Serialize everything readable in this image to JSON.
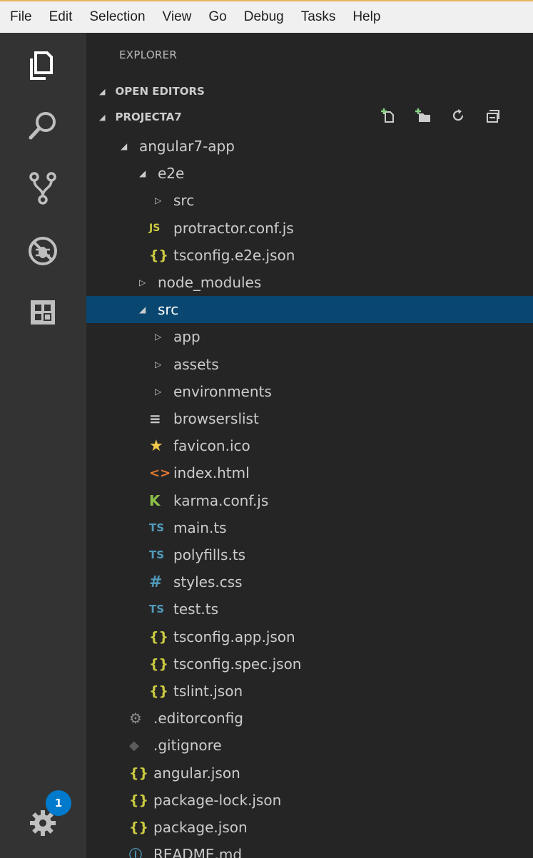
{
  "menu": [
    "File",
    "Edit",
    "Selection",
    "View",
    "Go",
    "Debug",
    "Tasks",
    "Help"
  ],
  "activity_bar": {
    "items": [
      "files-icon",
      "search-icon",
      "source-control-icon",
      "debug-icon",
      "extensions-icon"
    ],
    "settings_badge": "1"
  },
  "sidebar": {
    "title": "EXPLORER",
    "sections": {
      "open_editors": "OPEN EDITORS",
      "project": "PROJECTA7"
    },
    "header_actions": [
      "new-file-icon",
      "new-folder-icon",
      "refresh-icon",
      "collapse-all-icon"
    ]
  },
  "tree": [
    {
      "label": "angular7-app",
      "depth": 0,
      "type": "folder",
      "expanded": true
    },
    {
      "label": "e2e",
      "depth": 1,
      "type": "folder",
      "expanded": true
    },
    {
      "label": "src",
      "depth": 2,
      "type": "folder",
      "expanded": false
    },
    {
      "label": "protractor.conf.js",
      "depth": 2,
      "type": "file",
      "icon": "JS"
    },
    {
      "label": "tsconfig.e2e.json",
      "depth": 2,
      "type": "file",
      "icon": "{}"
    },
    {
      "label": "node_modules",
      "depth": 1,
      "type": "folder",
      "expanded": false
    },
    {
      "label": "src",
      "depth": 1,
      "type": "folder",
      "expanded": true,
      "selected": true
    },
    {
      "label": "app",
      "depth": 2,
      "type": "folder",
      "expanded": false
    },
    {
      "label": "assets",
      "depth": 2,
      "type": "folder",
      "expanded": false
    },
    {
      "label": "environments",
      "depth": 2,
      "type": "folder",
      "expanded": false
    },
    {
      "label": "browserslist",
      "depth": 2,
      "type": "file",
      "icon": "≡"
    },
    {
      "label": "favicon.ico",
      "depth": 2,
      "type": "file",
      "icon": "★"
    },
    {
      "label": "index.html",
      "depth": 2,
      "type": "file",
      "icon": "<>"
    },
    {
      "label": "karma.conf.js",
      "depth": 2,
      "type": "file",
      "icon": "K"
    },
    {
      "label": "main.ts",
      "depth": 2,
      "type": "file",
      "icon": "TS"
    },
    {
      "label": "polyfills.ts",
      "depth": 2,
      "type": "file",
      "icon": "TS"
    },
    {
      "label": "styles.css",
      "depth": 2,
      "type": "file",
      "icon": "#"
    },
    {
      "label": "test.ts",
      "depth": 2,
      "type": "file",
      "icon": "TS"
    },
    {
      "label": "tsconfig.app.json",
      "depth": 2,
      "type": "file",
      "icon": "{}"
    },
    {
      "label": "tsconfig.spec.json",
      "depth": 2,
      "type": "file",
      "icon": "{}"
    },
    {
      "label": "tslint.json",
      "depth": 2,
      "type": "file",
      "icon": "{}"
    },
    {
      "label": ".editorconfig",
      "depth": 1,
      "type": "file",
      "icon": "⚙"
    },
    {
      "label": ".gitignore",
      "depth": 1,
      "type": "file",
      "icon": "◆"
    },
    {
      "label": "angular.json",
      "depth": 1,
      "type": "file",
      "icon": "{}"
    },
    {
      "label": "package-lock.json",
      "depth": 1,
      "type": "file",
      "icon": "{}"
    },
    {
      "label": "package.json",
      "depth": 1,
      "type": "file",
      "icon": "{}"
    },
    {
      "label": "README.md",
      "depth": 1,
      "type": "file",
      "icon": "ⓘ"
    }
  ],
  "colors": {
    "activity_bar": "#333333",
    "sidebar": "#252526",
    "selection": "#094771",
    "badge": "#007acc",
    "json_icon": "#cbcb41",
    "ts_icon": "#519aba",
    "html_icon": "#e37933",
    "karma_icon": "#8dc149"
  }
}
